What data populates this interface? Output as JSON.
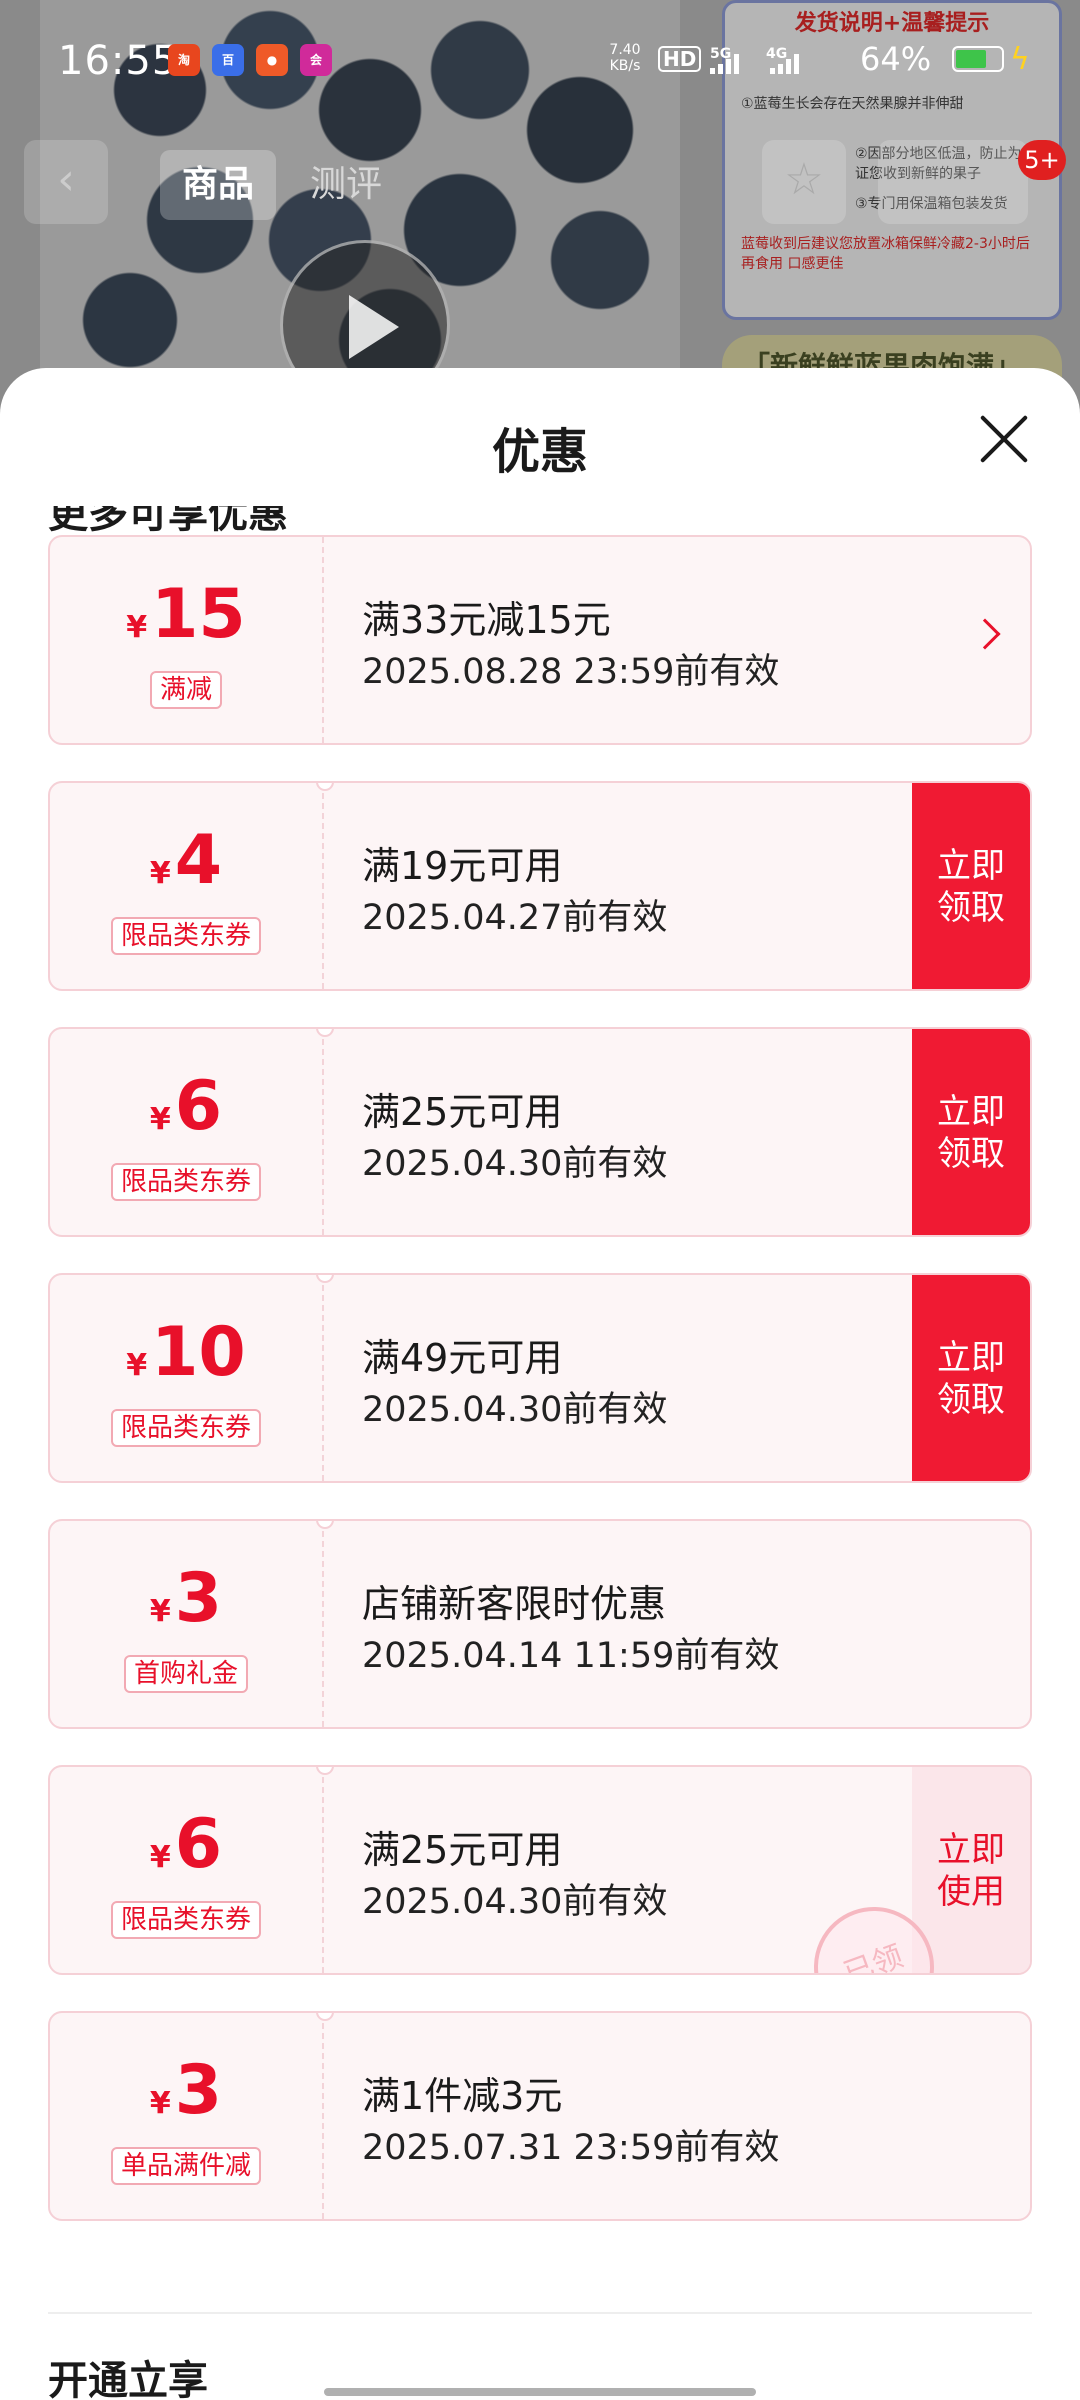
{
  "status_bar": {
    "time": "16:55",
    "net_speed": "7.40\nKB/s",
    "hd": "HD",
    "sig1": "5G",
    "sig2": "4G",
    "battery": "64%"
  },
  "background": {
    "tabs": [
      "商品",
      "测评"
    ],
    "info_title": "发货说明+温馨提示",
    "info_lines": [
      "①蓝莓生长会存在天然果腺并非伸甜",
      "②因部分地区低温，防止为保证您收到新鲜的果子",
      "③专门用保温箱包装发货",
      "蓝莓收到后建议您放置冰箱保鲜冷藏2-3小时后再食用 口感更佳"
    ],
    "banner": "「新鲜鲜蓝果肉饱满」",
    "badge": "5+"
  },
  "sheet": {
    "title": "优惠",
    "section_head": "更多可享优惠",
    "footer_head": "开通立享"
  },
  "coupons": [
    {
      "yen": "¥",
      "amount": "15",
      "tag": "满减",
      "condition": "满33元减15元",
      "validity": "2025.08.28 23:59前有效",
      "action": "",
      "action_type": "arrow"
    },
    {
      "yen": "¥",
      "amount": "4",
      "tag": "限品类东券",
      "condition": "满19元可用",
      "validity": "2025.04.27前有效",
      "action": "立即\n领取",
      "action_type": "claim"
    },
    {
      "yen": "¥",
      "amount": "6",
      "tag": "限品类东券",
      "condition": "满25元可用",
      "validity": "2025.04.30前有效",
      "action": "立即\n领取",
      "action_type": "claim"
    },
    {
      "yen": "¥",
      "amount": "10",
      "tag": "限品类东券",
      "condition": "满49元可用",
      "validity": "2025.04.30前有效",
      "action": "立即\n领取",
      "action_type": "claim"
    },
    {
      "yen": "¥",
      "amount": "3",
      "tag": "首购礼金",
      "condition": "店铺新客限时优惠",
      "validity": "2025.04.14 11:59前有效",
      "action": "",
      "action_type": "none"
    },
    {
      "yen": "¥",
      "amount": "6",
      "tag": "限品类东券",
      "condition": "满25元可用",
      "validity": "2025.04.30前有效",
      "action": "立即\n使用",
      "action_type": "use",
      "stamp": "已领"
    },
    {
      "yen": "¥",
      "amount": "3",
      "tag": "单品满件减",
      "condition": "满1件减3元",
      "validity": "2025.07.31 23:59前有效",
      "action": "",
      "action_type": "none"
    }
  ],
  "colors": {
    "accent": "#e8102a",
    "button": "#f01a33",
    "coupon_bg": "#fdf5f6"
  }
}
